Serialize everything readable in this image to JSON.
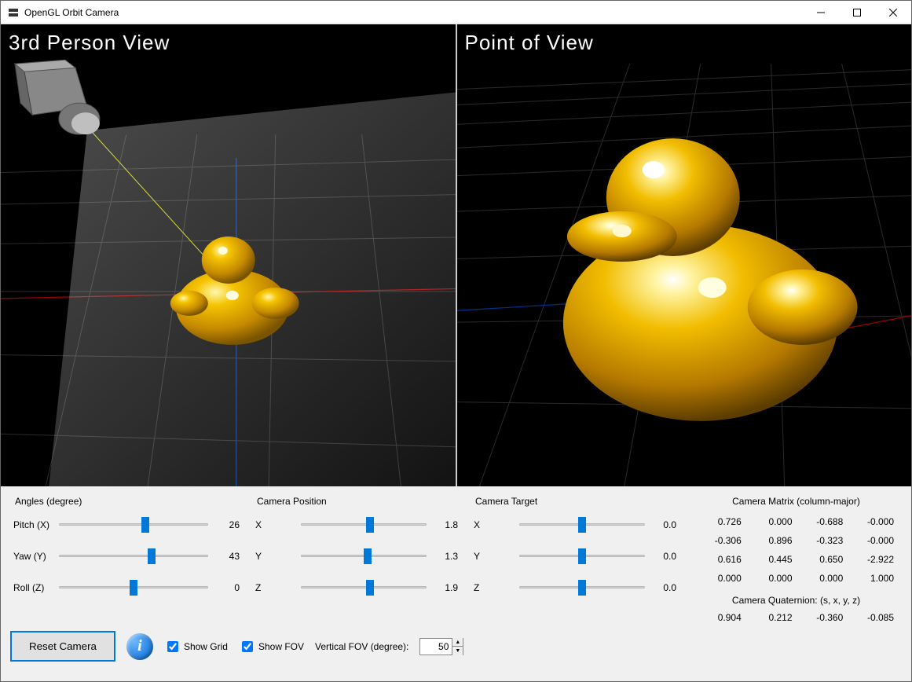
{
  "window": {
    "title": "OpenGL Orbit Camera"
  },
  "viewports": {
    "left_label": "3rd Person View",
    "right_label": "Point of View"
  },
  "angles": {
    "heading": "Angles (degree)",
    "pitch": {
      "label": "Pitch (X)",
      "value": "26",
      "pct": 58
    },
    "yaw": {
      "label": "Yaw (Y)",
      "value": "43",
      "pct": 62
    },
    "roll": {
      "label": "Roll (Z)",
      "value": "0",
      "pct": 50
    }
  },
  "camera_position": {
    "heading": "Camera Position",
    "x": {
      "label": "X",
      "value": "1.8",
      "pct": 55
    },
    "y": {
      "label": "Y",
      "value": "1.3",
      "pct": 53
    },
    "z": {
      "label": "Z",
      "value": "1.9",
      "pct": 55
    }
  },
  "camera_target": {
    "heading": "Camera Target",
    "x": {
      "label": "X",
      "value": "0.0",
      "pct": 50
    },
    "y": {
      "label": "Y",
      "value": "0.0",
      "pct": 50
    },
    "z": {
      "label": "Z",
      "value": "0.0",
      "pct": 50
    }
  },
  "matrix": {
    "heading": "Camera Matrix (column-major)",
    "m00": "0.726",
    "m01": "0.000",
    "m02": "-0.688",
    "m03": "-0.000",
    "m10": "-0.306",
    "m11": "0.896",
    "m12": "-0.323",
    "m13": "-0.000",
    "m20": "0.616",
    "m21": "0.445",
    "m22": "0.650",
    "m23": "-2.922",
    "m30": "0.000",
    "m31": "0.000",
    "m32": "0.000",
    "m33": "1.000"
  },
  "quaternion": {
    "heading": "Camera Quaternion: (s, x, y, z)",
    "s": "0.904",
    "x": "0.212",
    "y": "-0.360",
    "z": "-0.085"
  },
  "footer": {
    "reset_label": "Reset Camera",
    "show_grid_label": "Show Grid",
    "show_fov_label": "Show FOV",
    "fov_label": "Vertical FOV (degree):",
    "fov_value": "50",
    "show_grid_checked": true,
    "show_fov_checked": true
  }
}
